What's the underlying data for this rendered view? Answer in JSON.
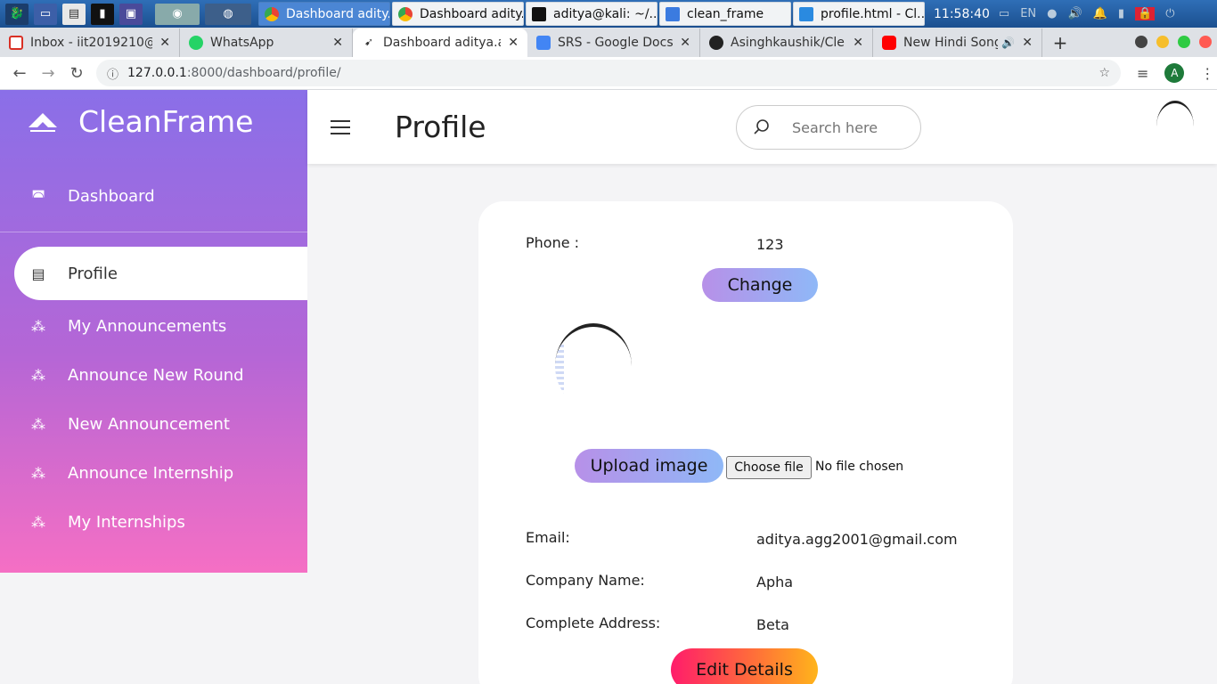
{
  "taskbar": {
    "apps": [
      {
        "label": "Dashboard adity...",
        "active": true
      },
      {
        "label": "Dashboard adity..."
      },
      {
        "label": "aditya@kali: ~/..."
      },
      {
        "label": "clean_frame"
      },
      {
        "label": "profile.html - Cl..."
      }
    ],
    "clock": "11:58:40",
    "lang": "EN"
  },
  "browser": {
    "tabs": [
      {
        "label": "Inbox - iit2019210@",
        "fav_color": "#d93025"
      },
      {
        "label": "WhatsApp",
        "fav_color": "#25d366"
      },
      {
        "label": "Dashboard aditya.a",
        "fav_color": "#333333",
        "active": true
      },
      {
        "label": "SRS - Google Docs",
        "fav_color": "#4285f4"
      },
      {
        "label": "Asinghkaushik/Cle",
        "fav_color": "#222222"
      },
      {
        "label": "New Hindi Song",
        "fav_color": "#ff0000"
      }
    ],
    "url_host": "127.0.0.1",
    "url_path": ":8000/dashboard/profile/",
    "avatar_letter": "A"
  },
  "sidebar": {
    "brand": "CleanFrame",
    "items": [
      {
        "label": "Dashboard",
        "icon": "dashboard-icon"
      },
      {
        "label": "Profile",
        "icon": "id-card-icon",
        "active": true
      },
      {
        "label": "My Announcements",
        "icon": "users-icon"
      },
      {
        "label": "Announce New Round",
        "icon": "users-icon"
      },
      {
        "label": "New Announcement",
        "icon": "users-icon"
      },
      {
        "label": "Announce Internship",
        "icon": "users-icon"
      },
      {
        "label": "My Internships",
        "icon": "users-icon"
      }
    ]
  },
  "header": {
    "title": "Profile",
    "search_placeholder": "Search here"
  },
  "profile": {
    "phone_label": "Phone :",
    "phone_value": "123",
    "change_label": "Change",
    "upload_label": "Upload image",
    "choose_file_label": "Choose file",
    "file_status": "No file chosen",
    "email_label": "Email:",
    "email_value": "aditya.agg2001@gmail.com",
    "company_label": "Company Name:",
    "company_value": "Apha",
    "address_label": "Complete Address:",
    "address_value": "Beta",
    "edit_label": "Edit Details"
  }
}
